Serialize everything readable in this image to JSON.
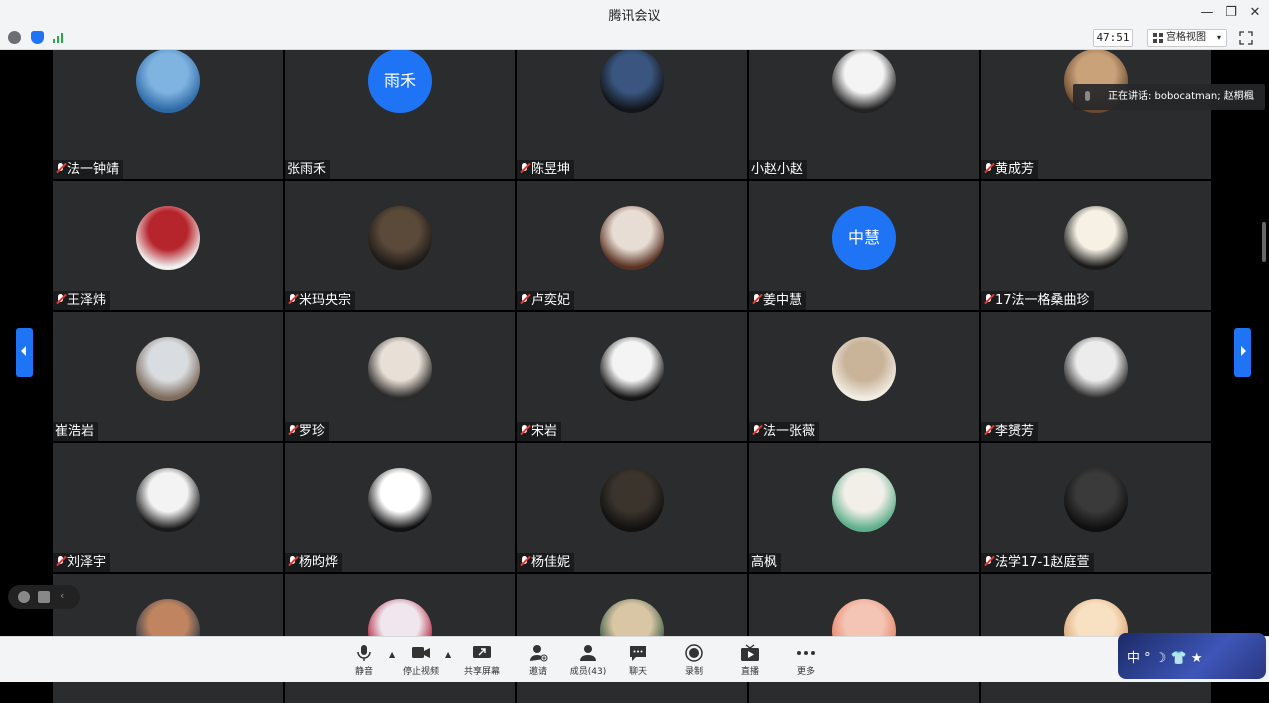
{
  "window": {
    "title": "腾讯会议"
  },
  "infobar": {
    "timer": "47:51",
    "view_label": "宫格视图"
  },
  "speaking": {
    "text": "正在讲话: bobocatman; 赵桐楓"
  },
  "participants": [
    {
      "name": "法一钟靖",
      "muted": true,
      "avatar": "photo",
      "colors": [
        "#7fb4e0",
        "#2f6aa7"
      ]
    },
    {
      "name": "张雨禾",
      "muted": false,
      "avatar": "text",
      "initials": "雨禾"
    },
    {
      "name": "陈昱坤",
      "muted": true,
      "avatar": "photo",
      "colors": [
        "#3a5680",
        "#111418"
      ]
    },
    {
      "name": "小赵小赵",
      "muted": false,
      "avatar": "photo",
      "colors": [
        "#f4f4f4",
        "#222"
      ]
    },
    {
      "name": "黄成芳",
      "muted": true,
      "avatar": "photo",
      "colors": [
        "#c9a27a",
        "#6b4a30"
      ]
    },
    {
      "name": "王泽炜",
      "muted": true,
      "avatar": "photo",
      "colors": [
        "#b7252c",
        "#f1f1f1"
      ]
    },
    {
      "name": "米玛央宗",
      "muted": true,
      "avatar": "photo",
      "colors": [
        "#5b4a3a",
        "#1d1a17"
      ]
    },
    {
      "name": "卢奕妃",
      "muted": true,
      "avatar": "photo",
      "colors": [
        "#e8ddd4",
        "#5a3324"
      ]
    },
    {
      "name": "姜中慧",
      "muted": true,
      "avatar": "text",
      "initials": "中慧"
    },
    {
      "name": "17法一格桑曲珍",
      "muted": true,
      "avatar": "photo",
      "colors": [
        "#f6f1e4",
        "#1b1b1b"
      ]
    },
    {
      "name": "崔浩岩",
      "muted": false,
      "avatar": "photo",
      "colors": [
        "#d9dce0",
        "#7d6b5c"
      ]
    },
    {
      "name": "罗珍",
      "muted": true,
      "avatar": "photo",
      "colors": [
        "#e8dfd6",
        "#2a2a2a"
      ]
    },
    {
      "name": "宋岩",
      "muted": true,
      "avatar": "photo",
      "colors": [
        "#f4f4f4",
        "#151515"
      ]
    },
    {
      "name": "法一张薇",
      "muted": true,
      "avatar": "photo",
      "colors": [
        "#c9b49a",
        "#f2ece2"
      ]
    },
    {
      "name": "李赟芳",
      "muted": true,
      "avatar": "photo",
      "colors": [
        "#ececec",
        "#2c2c2c"
      ]
    },
    {
      "name": "刘泽宇",
      "muted": true,
      "avatar": "photo",
      "colors": [
        "#f3f3f3",
        "#1a1a1a"
      ]
    },
    {
      "name": "杨昀烨",
      "muted": true,
      "avatar": "photo",
      "colors": [
        "#ffffff",
        "#111111"
      ]
    },
    {
      "name": "杨佳妮",
      "muted": true,
      "avatar": "photo",
      "colors": [
        "#3a342c",
        "#121110"
      ]
    },
    {
      "name": "高枫",
      "muted": false,
      "avatar": "photo",
      "colors": [
        "#f2efe8",
        "#5fae8c"
      ]
    },
    {
      "name": "法学17-1赵庭萱",
      "muted": true,
      "avatar": "photo",
      "colors": [
        "#3a3a3a",
        "#0f0f0f"
      ]
    },
    {
      "name": "",
      "muted": false,
      "avatar": "photo",
      "colors": [
        "#c08560",
        "#2d3a4a"
      ]
    },
    {
      "name": "",
      "muted": false,
      "avatar": "photo",
      "colors": [
        "#efe6ee",
        "#b2203a"
      ]
    },
    {
      "name": "",
      "muted": false,
      "avatar": "photo",
      "colors": [
        "#d9c6a4",
        "#3a5b46"
      ]
    },
    {
      "name": "",
      "muted": false,
      "avatar": "photo",
      "colors": [
        "#f4c4b4",
        "#e58464"
      ]
    },
    {
      "name": "",
      "muted": false,
      "avatar": "photo",
      "colors": [
        "#f8e0c2",
        "#d9a472"
      ]
    }
  ],
  "toolbar": {
    "mute": "静音",
    "stop_video": "停止视频",
    "share": "共享屏幕",
    "invite": "邀请",
    "members": "成员(43)",
    "chat": "聊天",
    "record": "录制",
    "live": "直播",
    "more": "更多"
  },
  "ime": {
    "text": "中 ° ☽ 👕 ★"
  },
  "colors": {
    "accent": "#1f74f5",
    "tile_bg": "#2b2c2e",
    "stage_bg": "#000000"
  }
}
